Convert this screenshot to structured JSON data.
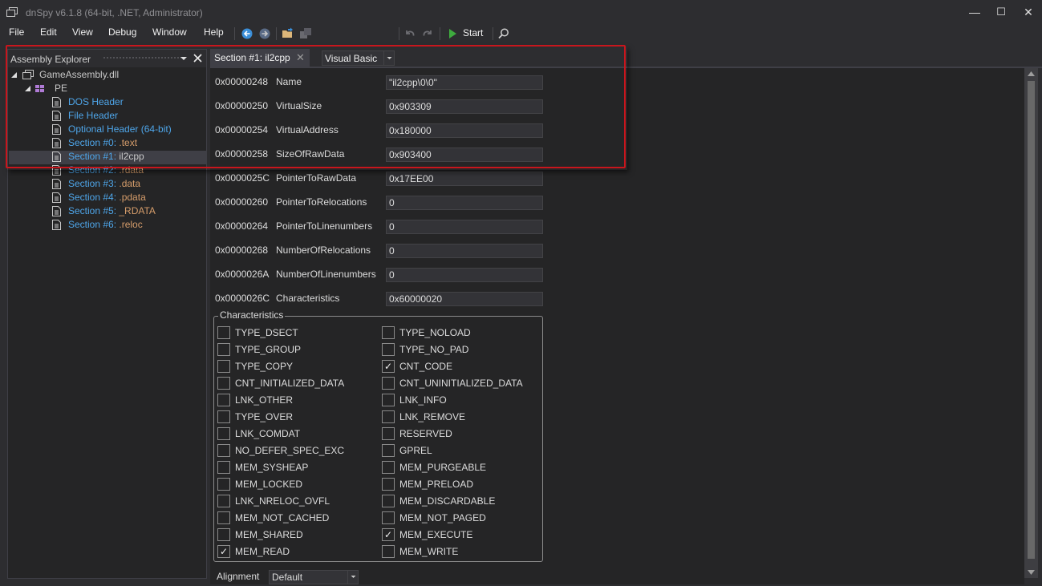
{
  "window": {
    "title": "dnSpy v6.1.8 (64-bit, .NET, Administrator)",
    "controls": [
      "—",
      "☐",
      "✕"
    ]
  },
  "menu": [
    "File",
    "Edit",
    "View",
    "Debug",
    "Window",
    "Help"
  ],
  "toolbar": {
    "language": "Visual Basic",
    "start_label": "Start",
    "icons": [
      "back-arrow-icon",
      "forward-arrow-icon",
      "open-folder-icon",
      "save-icon",
      "undo-icon",
      "redo-icon",
      "start-icon",
      "search-icon"
    ]
  },
  "explorer": {
    "title": "Assembly Explorer",
    "root": "GameAssembly.dll",
    "pe": "PE",
    "items": [
      {
        "prefix": "DOS Header",
        "suffix": ""
      },
      {
        "prefix": "File Header",
        "suffix": ""
      },
      {
        "prefix": "Optional Header (64-bit)",
        "suffix": ""
      },
      {
        "prefix": "Section #0: ",
        "suffix": ".text"
      },
      {
        "prefix": "Section #1: ",
        "suffix": "il2cpp"
      },
      {
        "prefix": "Section #2: ",
        "suffix": ".rdata"
      },
      {
        "prefix": "Section #3: ",
        "suffix": ".data"
      },
      {
        "prefix": "Section #4: ",
        "suffix": ".pdata"
      },
      {
        "prefix": "Section #5: ",
        "suffix": "_RDATA"
      },
      {
        "prefix": "Section #6: ",
        "suffix": ".reloc"
      }
    ],
    "selected_index": 4
  },
  "tab": {
    "title": "Section #1: il2cpp",
    "close": "✕"
  },
  "fields": [
    {
      "offset": "0x00000248",
      "name": "Name",
      "value": "\"il2cpp\\0\\0\""
    },
    {
      "offset": "0x00000250",
      "name": "VirtualSize",
      "value": "0x903309"
    },
    {
      "offset": "0x00000254",
      "name": "VirtualAddress",
      "value": "0x180000"
    },
    {
      "offset": "0x00000258",
      "name": "SizeOfRawData",
      "value": "0x903400"
    },
    {
      "offset": "0x0000025C",
      "name": "PointerToRawData",
      "value": "0x17EE00"
    },
    {
      "offset": "0x00000260",
      "name": "PointerToRelocations",
      "value": "0"
    },
    {
      "offset": "0x00000264",
      "name": "PointerToLinenumbers",
      "value": "0"
    },
    {
      "offset": "0x00000268",
      "name": "NumberOfRelocations",
      "value": "0"
    },
    {
      "offset": "0x0000026A",
      "name": "NumberOfLinenumbers",
      "value": "0"
    },
    {
      "offset": "0x0000026C",
      "name": "Characteristics",
      "value": "0x60000020"
    }
  ],
  "characteristics": {
    "title": "Characteristics",
    "left": [
      {
        "label": "TYPE_DSECT",
        "checked": false
      },
      {
        "label": "TYPE_GROUP",
        "checked": false
      },
      {
        "label": "TYPE_COPY",
        "checked": false
      },
      {
        "label": "CNT_INITIALIZED_DATA",
        "checked": false
      },
      {
        "label": "LNK_OTHER",
        "checked": false
      },
      {
        "label": "TYPE_OVER",
        "checked": false
      },
      {
        "label": "LNK_COMDAT",
        "checked": false
      },
      {
        "label": "NO_DEFER_SPEC_EXC",
        "checked": false
      },
      {
        "label": "MEM_SYSHEAP",
        "checked": false
      },
      {
        "label": "MEM_LOCKED",
        "checked": false
      },
      {
        "label": "LNK_NRELOC_OVFL",
        "checked": false
      },
      {
        "label": "MEM_NOT_CACHED",
        "checked": false
      },
      {
        "label": "MEM_SHARED",
        "checked": false
      },
      {
        "label": "MEM_READ",
        "checked": true
      }
    ],
    "right": [
      {
        "label": "TYPE_NOLOAD",
        "checked": false
      },
      {
        "label": "TYPE_NO_PAD",
        "checked": false
      },
      {
        "label": "CNT_CODE",
        "checked": true
      },
      {
        "label": "CNT_UNINITIALIZED_DATA",
        "checked": false
      },
      {
        "label": "LNK_INFO",
        "checked": false
      },
      {
        "label": "LNK_REMOVE",
        "checked": false
      },
      {
        "label": "RESERVED",
        "checked": false
      },
      {
        "label": "GPREL",
        "checked": false
      },
      {
        "label": "MEM_PURGEABLE",
        "checked": false
      },
      {
        "label": "MEM_PRELOAD",
        "checked": false
      },
      {
        "label": "MEM_DISCARDABLE",
        "checked": false
      },
      {
        "label": "MEM_NOT_PAGED",
        "checked": false
      },
      {
        "label": "MEM_EXECUTE",
        "checked": true
      },
      {
        "label": "MEM_WRITE",
        "checked": false
      }
    ],
    "check_glyph": "✓"
  },
  "alignment": {
    "label": "Alignment",
    "value": "Default"
  },
  "colors": {
    "link": "#4ea6ea",
    "section_name": "#d69d6b",
    "highlight": "#c8161d",
    "background": "#252526"
  }
}
